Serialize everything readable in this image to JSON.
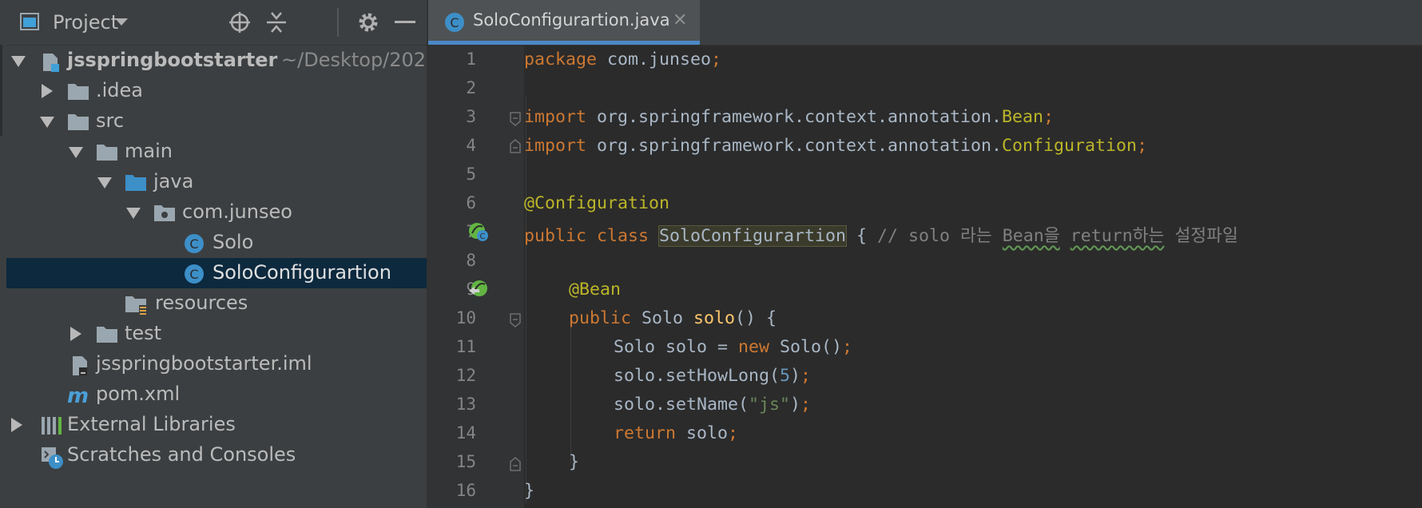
{
  "project_panel": {
    "title": "Project",
    "tree": [
      {
        "label": "jsspringbootstarter",
        "suffix": "~/Desktop/202",
        "bold": true,
        "arrow": "down",
        "icon": "module-icon",
        "level": 0
      },
      {
        "label": ".idea",
        "arrow": "right",
        "icon": "folder-icon",
        "level": 1
      },
      {
        "label": "src",
        "arrow": "down",
        "icon": "folder-icon",
        "level": 1
      },
      {
        "label": "main",
        "arrow": "down",
        "icon": "folder-icon",
        "level": 2
      },
      {
        "label": "java",
        "arrow": "down",
        "icon": "source-folder-icon",
        "level": 3
      },
      {
        "label": "com.junseo",
        "arrow": "down",
        "icon": "package-icon",
        "level": 4
      },
      {
        "label": "Solo",
        "icon": "java-class-icon",
        "level": 5
      },
      {
        "label": "SoloConfigurartion",
        "icon": "java-class-icon",
        "level": 5,
        "selected": true
      },
      {
        "label": "resources",
        "icon": "resources-folder-icon",
        "level": 3
      },
      {
        "label": "test",
        "arrow": "right",
        "icon": "folder-icon",
        "level": 2
      },
      {
        "label": "jsspringbootstarter.iml",
        "icon": "iml-file-icon",
        "level": 1
      },
      {
        "label": "pom.xml",
        "icon": "maven-icon",
        "level": 1
      },
      {
        "label": "External Libraries",
        "arrow": "right",
        "icon": "libraries-icon",
        "level": 0
      },
      {
        "label": "Scratches and Consoles",
        "icon": "scratches-icon",
        "level": 0
      }
    ]
  },
  "editor": {
    "tab_label": "SoloConfigurartion.java",
    "tab_close": "✕",
    "line_numbers": [
      "1",
      "2",
      "3",
      "4",
      "5",
      "6",
      "7",
      "8",
      "9",
      "10",
      "11",
      "12",
      "13",
      "14",
      "15",
      "16"
    ],
    "code": {
      "l1_kw": "package",
      "l1_rest": " com.junseo",
      "l1_semi": ";",
      "l3_kw": "import",
      "l3_rest": " org.springframework.context.annotation.",
      "l3_cls": "Bean",
      "l3_semi": ";",
      "l4_kw": "import",
      "l4_rest": " org.springframework.context.annotation.",
      "l4_cls": "Configuration",
      "l4_semi": ";",
      "l6_ann": "@Configuration",
      "l7_kw": "public class ",
      "l7_name": "SoloConfigurartion",
      "l7_brace": " { ",
      "l7_cmt1": "// solo 라는 ",
      "l7_cmt_bean": "Bean을",
      "l7_cmt_sp": " ",
      "l7_cmt_ret": "return하는",
      "l7_cmt2": " 설정파일",
      "l9_ann": "@Bean",
      "l10_kw": "public ",
      "l10_type": "Solo ",
      "l10_fn": "solo",
      "l10_rest": "() {",
      "l11_a": "Solo solo = ",
      "l11_kw": "new",
      "l11_b": " Solo()",
      "l11_semi": ";",
      "l12_a": "solo.setHowLong(",
      "l12_num": "5",
      "l12_b": ")",
      "l12_semi": ";",
      "l13_a": "solo.setName(",
      "l13_str": "\"js\"",
      "l13_b": ")",
      "l13_semi": ";",
      "l14_kw": "return",
      "l14_a": " solo",
      "l14_semi": ";",
      "l15": "}",
      "l16": "}"
    }
  },
  "colors": {
    "keyword": "#cc7832",
    "annotation": "#bbb529",
    "string": "#6a8759",
    "number": "#6897bb",
    "method": "#ffc66d",
    "comment": "#808080",
    "selection": "#0d293e",
    "tab_accent": "#4a88c7"
  }
}
